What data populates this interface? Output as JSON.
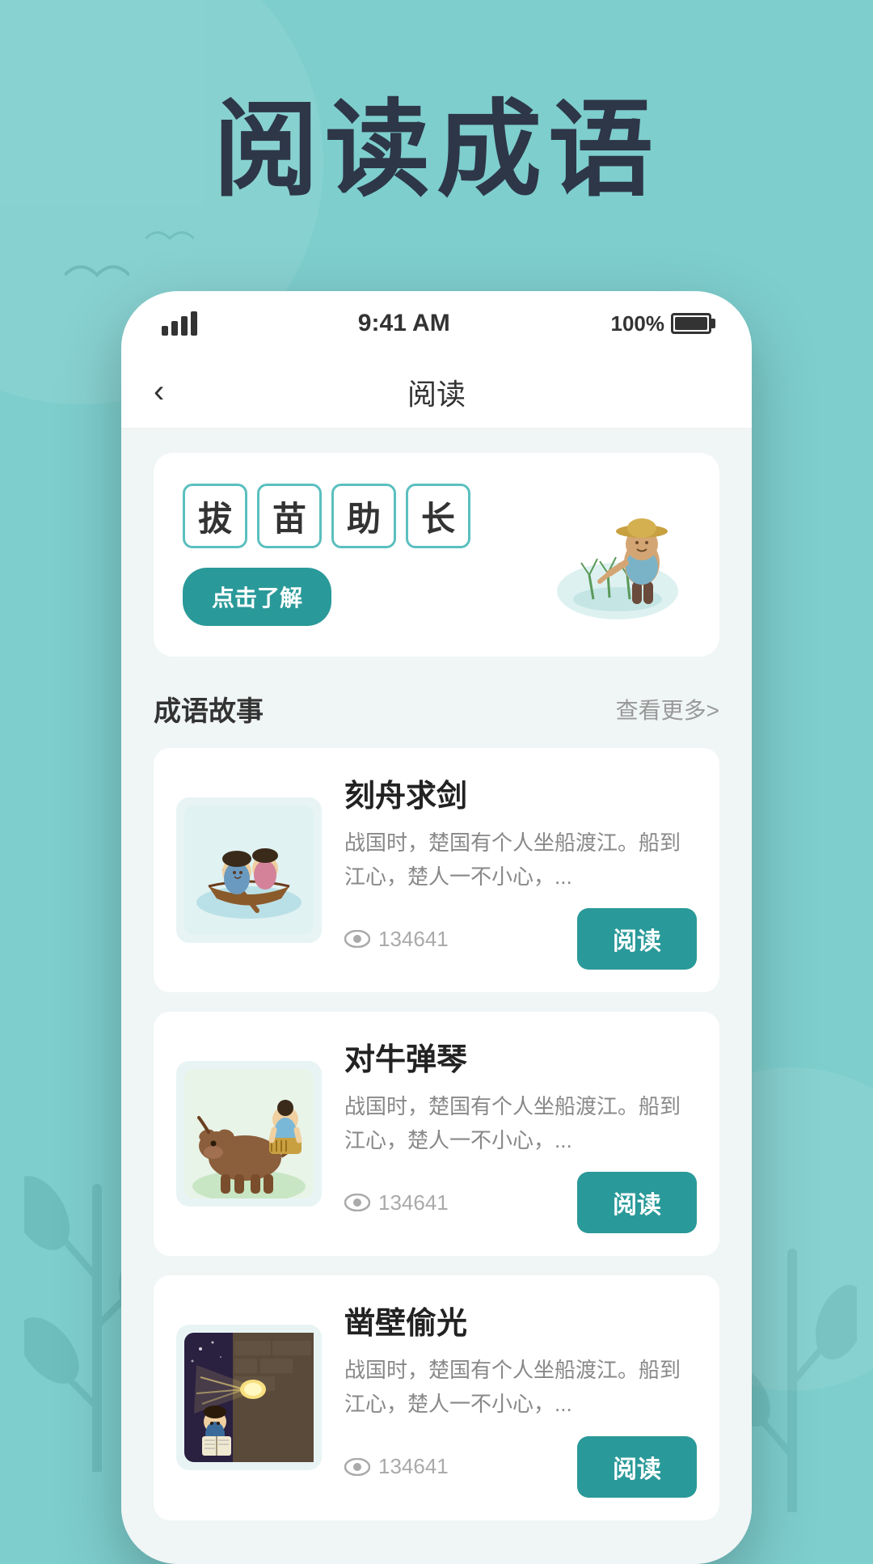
{
  "hero": {
    "title": "阅读成语"
  },
  "status_bar": {
    "time": "9:41 AM",
    "battery": "100%"
  },
  "nav": {
    "title": "阅读",
    "back_label": "‹"
  },
  "featured": {
    "chars": [
      "拔",
      "苗",
      "助",
      "长"
    ],
    "button_label": "点击了解"
  },
  "stories_section": {
    "title": "成语故事",
    "see_more": "查看更多>"
  },
  "stories": [
    {
      "title": "刻舟求剑",
      "desc": "战国时，楚国有个人坐船渡江。船到江心，楚人一不小心，...",
      "views": "134641",
      "read_label": "阅读",
      "illustration_type": "boat"
    },
    {
      "title": "对牛弹琴",
      "desc": "战国时，楚国有个人坐船渡江。船到江心，楚人一不小心，...",
      "views": "134641",
      "read_label": "阅读",
      "illustration_type": "cow"
    },
    {
      "title": "凿壁偷光",
      "desc": "战国时，楚国有个人坐船渡江。船到江心，楚人一不小心，...",
      "views": "134641",
      "read_label": "阅读",
      "illustration_type": "wall"
    }
  ],
  "colors": {
    "primary": "#2a9999",
    "bg": "#7ecece",
    "card_bg": "white"
  }
}
